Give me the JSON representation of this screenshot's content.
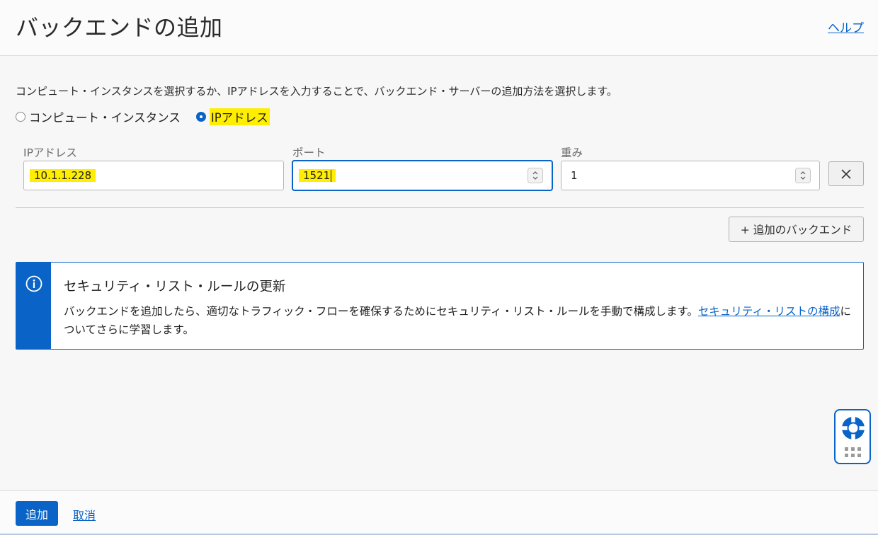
{
  "header": {
    "title": "バックエンドの追加",
    "help_label": "ヘルプ"
  },
  "intro_text": "コンピュート・インスタンスを選択するか、IPアドレスを入力することで、バックエンド・サーバーの追加方法を選択します。",
  "radio": {
    "options": [
      {
        "label": "コンピュート・インスタンス",
        "selected": false
      },
      {
        "label": "IPアドレス",
        "selected": true
      }
    ]
  },
  "backend_row": {
    "ip_label": "IPアドレス",
    "ip_value": "10.1.1.228",
    "port_label": "ポート",
    "port_value": "1521",
    "weight_label": "重み",
    "weight_value": "1"
  },
  "add_backend_label": "+ 追加のバックエンド",
  "info": {
    "title": "セキュリティ・リスト・ルールの更新",
    "text_before": "バックエンドを追加したら、適切なトラフィック・フローを確保するためにセキュリティ・リスト・ルールを手動で構成します。",
    "link_text": "セキュリティ・リストの構成",
    "text_after": "についてさらに学習します。"
  },
  "footer": {
    "add_label": "追加",
    "cancel_label": "取消"
  },
  "colors": {
    "accent": "#0a63c6",
    "highlight": "#ffee00"
  },
  "icons": [
    "info-icon",
    "close-icon",
    "spinner-icon",
    "lifebuoy-icon",
    "grip-icon"
  ]
}
